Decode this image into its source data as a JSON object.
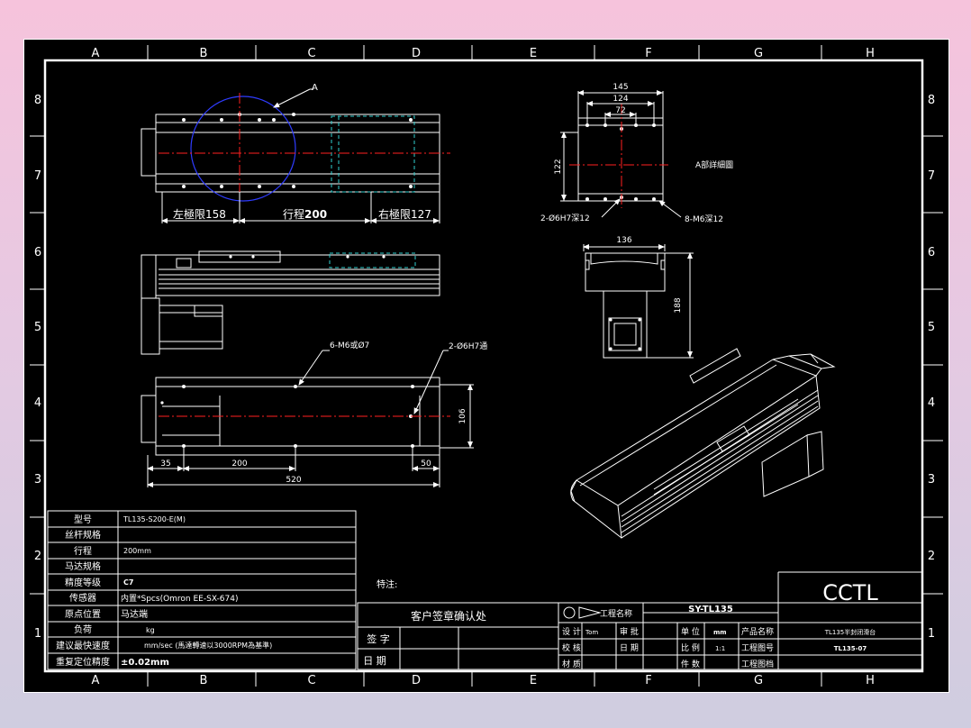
{
  "frame": {
    "col_letters": [
      "A",
      "B",
      "C",
      "D",
      "E",
      "F",
      "G",
      "H"
    ],
    "row_numbers": [
      "8",
      "7",
      "6",
      "5",
      "4",
      "3",
      "2",
      "1"
    ]
  },
  "colors": {
    "background": "#000000",
    "line": "#ffffff",
    "centerline": "#ff2020",
    "detail_circle": "#2f3cff",
    "stroke_zone": "#2fd0d0"
  },
  "top_view": {
    "callout": "A",
    "left_limit": "左極限158",
    "stroke": "行程",
    "stroke_value": "200",
    "right_limit": "右極限127"
  },
  "detail": {
    "w145": "145",
    "w124": "124",
    "w72": "72",
    "h122": "122",
    "title": "A部詳細圖",
    "note_pin": "2-Ø6H7深12",
    "note_tap": "8-M6深12"
  },
  "end_view": {
    "w136": "136",
    "h188": "188"
  },
  "bottom_view": {
    "note_holes": "6-M6或Ø7",
    "note_pin": "2-Ø6H7通",
    "d35": "35",
    "d200": "200",
    "d50": "50",
    "d520": "520",
    "d106": "106"
  },
  "spec_table": {
    "rows": [
      {
        "label": "型号",
        "value": "TL135-S200-E(M)"
      },
      {
        "label": "丝杆规格",
        "value": ""
      },
      {
        "label": "行程",
        "value": "200mm"
      },
      {
        "label": "马达规格",
        "value": ""
      },
      {
        "label": "精度等级",
        "value": "C7"
      },
      {
        "label": "传感器",
        "value": "内置*Spcs(Omron EE-SX-674)"
      },
      {
        "label": "原点位置",
        "value": "马达端"
      },
      {
        "label": "负荷",
        "value": "kg"
      },
      {
        "label": "建议最快速度",
        "value": "mm/sec (馬達轉速以3000RPM為基準)"
      },
      {
        "label": "重复定位精度",
        "value": "±0.02mm"
      }
    ]
  },
  "notes_label": "特注:",
  "customer": {
    "title": "客户签章确认处",
    "sign": "签 字",
    "date": "日 期"
  },
  "title_block": {
    "project_label": "工程名称",
    "drawing_no": "SY-TL135",
    "company": "CCTL",
    "design": "设 计",
    "designer": "Tom",
    "approve": "审 批",
    "unit_label": "单 位",
    "unit_value": "mm",
    "product_name_label": "产品名称",
    "product_name_value": "TL135半封闭滑台",
    "check": "校 核",
    "date": "日 期",
    "scale_label": "比 例",
    "scale_value": "1:1",
    "drawing_no_label": "工程图号",
    "drawing_no_value": "TL135-07",
    "material": "材 质",
    "count_label": "件 数",
    "archive_label": "工程图档"
  }
}
